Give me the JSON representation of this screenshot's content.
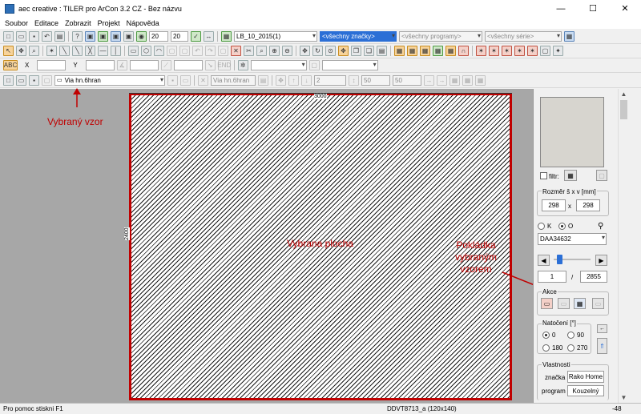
{
  "window": {
    "title": "aec creative : TILER pro ArCon 3.2 CZ  - Bez názvu",
    "minimize": "—",
    "maximize": "☐",
    "close": "✕"
  },
  "menu": [
    "Soubor",
    "Editace",
    "Zobrazit",
    "Projekt",
    "Nápověda"
  ],
  "toolbar1": {
    "field_a": "20",
    "field_b": "20",
    "catalog": "LB_10_2015(1)",
    "brands": "<všechny značky>",
    "programs": "<všechny programy>",
    "series": "<všechny série>"
  },
  "toolbar2": {
    "x_label": "X",
    "y_label": "Y"
  },
  "toolbar3": {
    "abc": "ABC",
    "x_label": "X",
    "y_label": "Y",
    "end_label": "END"
  },
  "toolbar4": {
    "pattern": "Via hn.6hran",
    "pattern_ref": "Via hn.6hran",
    "count": "2",
    "val_a": "50",
    "val_b": "50"
  },
  "canvas": {
    "width_label": "3000",
    "height_label": "2400"
  },
  "annotations": {
    "selected_pattern": "Vybraný vzor",
    "selected_area": "Vybrana plocha",
    "tile_with_pattern": "Pokládka\nvybraným\nvzorem"
  },
  "panel": {
    "filter_label": "filtr:",
    "size_label": "Rozměr š x v [mm]",
    "width": "298",
    "x_sep": "x",
    "height": "298",
    "opt_k": "K",
    "opt_o": "O",
    "code": "DAA34632",
    "page_current": "1",
    "page_sep": "/",
    "page_total": "2855",
    "actions_label": "Akce",
    "rotation_label": "Natočení [°]",
    "rot_0": "0",
    "rot_90": "90",
    "rot_180": "180",
    "rot_270": "270",
    "props_label": "Vlastnosti",
    "brand_key": "značka",
    "brand_value": "Rako Home",
    "program_key": "program",
    "program_value": "Kouzelný"
  },
  "status": {
    "help": "Pro pomoc stiskni F1",
    "tile": "DDVT8713_a (120x140)",
    "coord": "-48"
  },
  "colors": {
    "highlight": "#c00000",
    "selection": "#2b6fd6"
  }
}
